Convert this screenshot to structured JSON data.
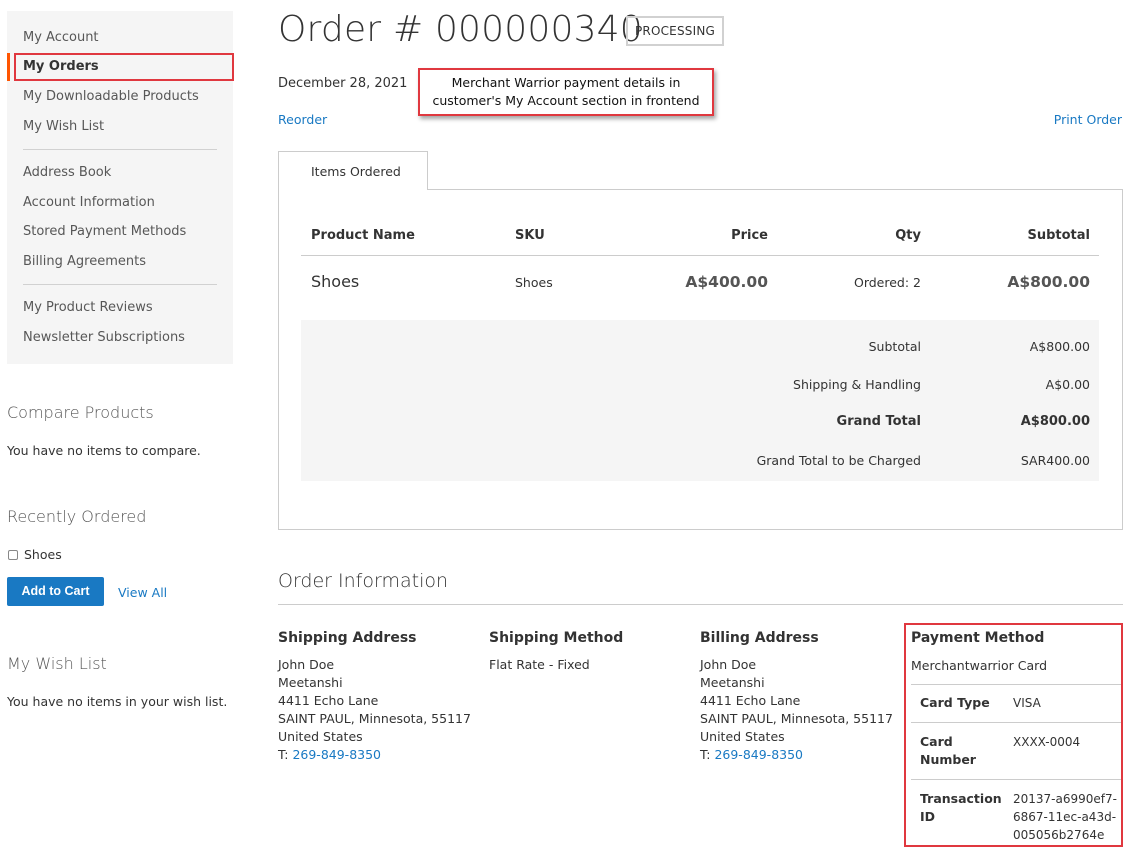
{
  "sidebar": {
    "nav_group1": [
      "My Account",
      "My Orders",
      "My Downloadable Products",
      "My Wish List"
    ],
    "nav_group2": [
      "Address Book",
      "Account Information",
      "Stored Payment Methods",
      "Billing Agreements"
    ],
    "nav_group3": [
      "My Product Reviews",
      "Newsletter Subscriptions"
    ],
    "compare": {
      "title": "Compare Products",
      "empty": "You have no items to compare."
    },
    "recent": {
      "title": "Recently Ordered",
      "item": "Shoes",
      "add_to_cart": "Add to Cart",
      "view_all": "View All"
    },
    "wishlist": {
      "title": "My Wish List",
      "empty": "You have no items in your wish list."
    }
  },
  "order": {
    "title": "Order # 000000340",
    "status": "PROCESSING",
    "date": "December 28, 2021",
    "reorder": "Reorder",
    "print": "Print Order"
  },
  "callout": {
    "line1": "Merchant Warrior payment details in",
    "line2": "customer's My Account section in frontend"
  },
  "items": {
    "tab": "Items Ordered",
    "headers": {
      "name": "Product Name",
      "sku": "SKU",
      "price": "Price",
      "qty": "Qty",
      "subtotal": "Subtotal"
    },
    "row": {
      "name": "Shoes",
      "sku": "Shoes",
      "price": "A$400.00",
      "qty": "Ordered: 2",
      "subtotal": "A$800.00"
    }
  },
  "totals": [
    {
      "label": "Subtotal",
      "value": "A$800.00"
    },
    {
      "label": "Shipping & Handling",
      "value": "A$0.00"
    },
    {
      "label": "Grand Total",
      "value": "A$800.00"
    },
    {
      "label": "Grand Total to be Charged",
      "value": "SAR400.00"
    }
  ],
  "info": {
    "title": "Order Information",
    "shipping_address": {
      "title": "Shipping Address",
      "lines": [
        "John Doe",
        "Meetanshi",
        "4411 Echo Lane",
        "SAINT PAUL, Minnesota, 55117",
        "United States"
      ],
      "phone_prefix": "T: ",
      "phone": "269-849-8350"
    },
    "shipping_method": {
      "title": "Shipping Method",
      "value": "Flat Rate - Fixed"
    },
    "billing_address": {
      "title": "Billing Address",
      "lines": [
        "John Doe",
        "Meetanshi",
        "4411 Echo Lane",
        "SAINT PAUL, Minnesota, 55117",
        "United States"
      ],
      "phone_prefix": "T: ",
      "phone": "269-849-8350"
    },
    "payment": {
      "title": "Payment Method",
      "method": "Merchantwarrior Card",
      "card_type_label": "Card Type",
      "card_type": "VISA",
      "card_number_label_1": "Card",
      "card_number_label_2": "Number",
      "card_number": "XXXX-0004",
      "transaction_label_1": "Transaction",
      "transaction_label_2": "ID",
      "transaction_1": "20137-a6990ef7-",
      "transaction_2": "6867-11ec-a43d-",
      "transaction_3": "005056b2764e"
    }
  },
  "colors": {
    "link": "#1979c3",
    "highlight": "#e0383f",
    "current_nav_bar": "#ff5501"
  }
}
